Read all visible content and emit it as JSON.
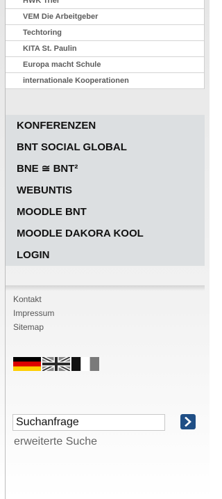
{
  "submenu": {
    "items": [
      {
        "label": "HWK Trier"
      },
      {
        "label": "VEM Die Arbeitgeber"
      },
      {
        "label": "Techtoring"
      },
      {
        "label": "KITA St. Paulin"
      },
      {
        "label": "Europa macht Schule"
      },
      {
        "label": "internationale Kooperationen"
      }
    ]
  },
  "mainmenu": {
    "items": [
      {
        "label": "KONFERENZEN"
      },
      {
        "label": "BNT SOCIAL GLOBAL"
      },
      {
        "label": "BNE ≅ BNT²"
      },
      {
        "label": "WEBUNTIS"
      },
      {
        "label": "MOODLE BNT"
      },
      {
        "label": "MOODLE DAKORA KOOL"
      },
      {
        "label": "LOGIN"
      }
    ]
  },
  "footer": {
    "links": [
      {
        "label": "Kontakt"
      },
      {
        "label": "Impressum"
      },
      {
        "label": "Sitemap"
      }
    ]
  },
  "languages": {
    "flags": [
      "german-flag-icon",
      "uk-flag-icon",
      "french-flag-icon"
    ]
  },
  "search": {
    "value": "Suchanfrage",
    "button_icon": "chevron-right-icon",
    "advanced_label": "erweiterte Suche"
  },
  "colors": {
    "menu_bg": "#dcdfe1",
    "search_button": "#1f4f86",
    "link_text": "#555555"
  }
}
